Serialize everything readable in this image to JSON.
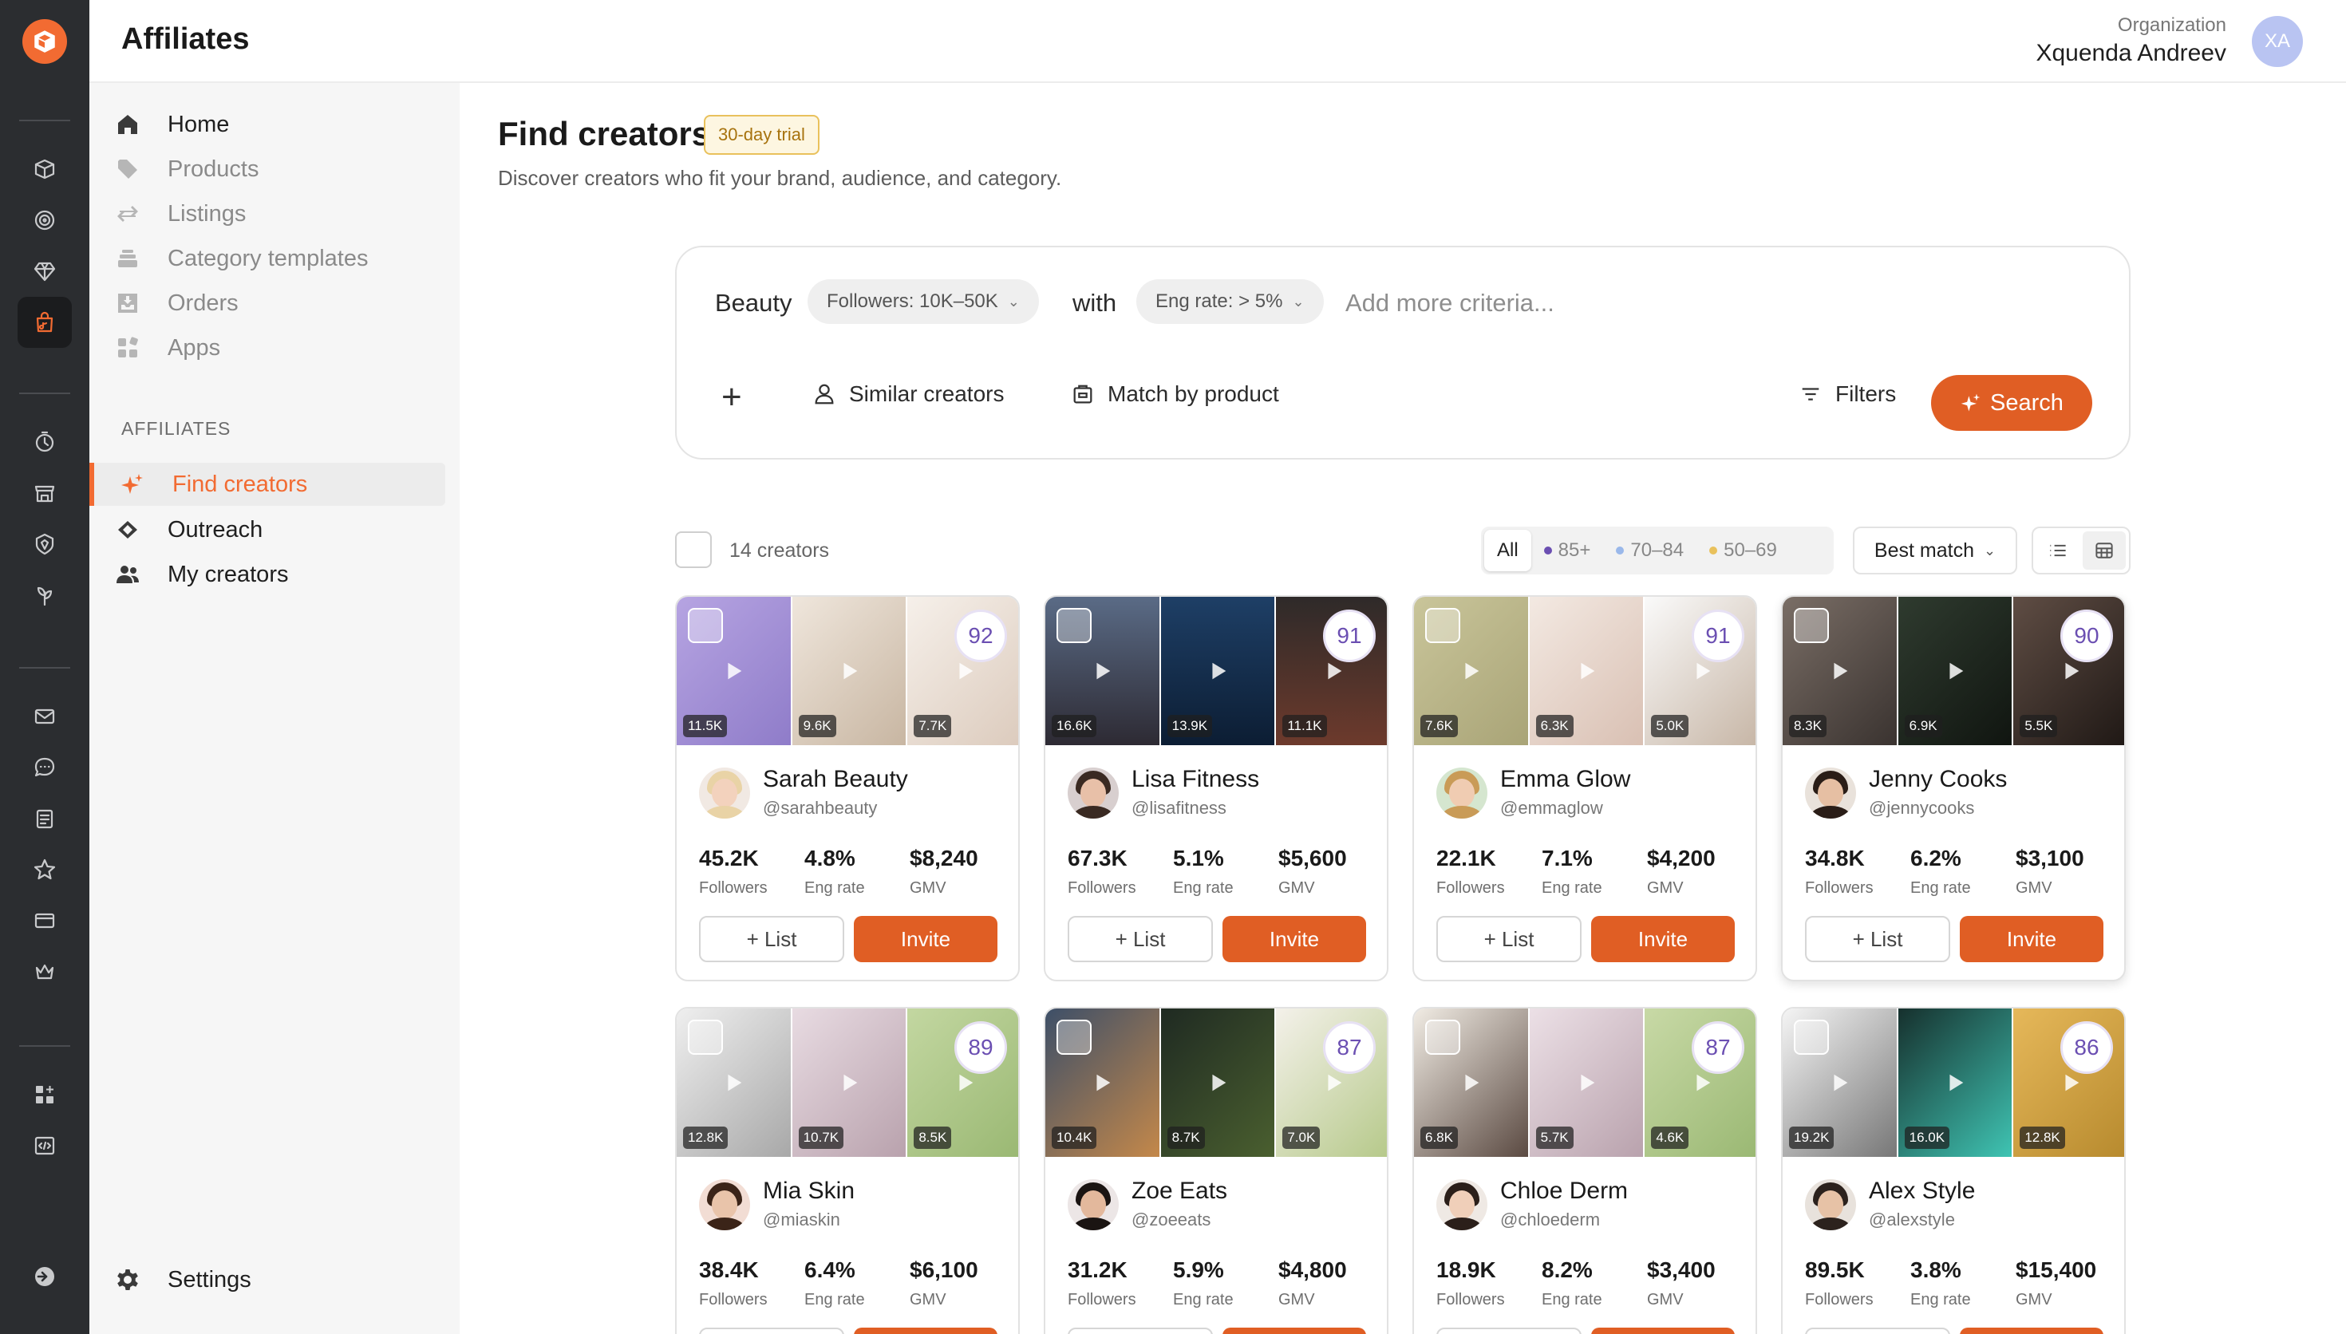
{
  "app": {
    "title": "Affiliates"
  },
  "org": {
    "label": "Organization",
    "name": "Xquenda Andreev",
    "initials": "XA"
  },
  "sidebar": {
    "items": [
      {
        "label": "Home",
        "icon": "home-icon"
      },
      {
        "label": "Products",
        "icon": "tag-icon"
      },
      {
        "label": "Listings",
        "icon": "sync-icon"
      },
      {
        "label": "Category templates",
        "icon": "stack-icon"
      },
      {
        "label": "Orders",
        "icon": "download-tray-icon"
      },
      {
        "label": "Apps",
        "icon": "apps-icon"
      }
    ],
    "section": "AFFILIATES",
    "affiliates": [
      {
        "label": "Find creators",
        "icon": "sparkle-icon"
      },
      {
        "label": "Outreach",
        "icon": "handshake-icon"
      },
      {
        "label": "My creators",
        "icon": "people-icon"
      }
    ],
    "settings": "Settings"
  },
  "page": {
    "title": "Find creators",
    "badge": "30-day trial",
    "subtitle": "Discover creators who fit your brand, audience, and category."
  },
  "search": {
    "keyword": "Beauty",
    "followers_chip": "Followers: 10K–50K",
    "with_label": "with",
    "eng_chip": "Eng rate: > 5%",
    "placeholder": "Add more criteria...",
    "add": "+",
    "similar": "Similar creators",
    "match": "Match by product",
    "filters": "Filters",
    "search_btn": "Search"
  },
  "results": {
    "count": "14 creators",
    "segments": [
      {
        "label": "All",
        "dot": ""
      },
      {
        "label": "85+",
        "dot": "#6b4fb2"
      },
      {
        "label": "70–84",
        "dot": "#9ab8ea"
      },
      {
        "label": "50–69",
        "dot": "#e9c15c"
      }
    ],
    "sort": "Best match"
  },
  "labels": {
    "followers": "Followers",
    "eng": "Eng rate",
    "gmv": "GMV",
    "list_btn": "+ List",
    "invite_btn": "Invite"
  },
  "creators": [
    {
      "name": "Sarah Beauty",
      "handle": "@sarahbeauty",
      "score": "92",
      "followers": "45.2K",
      "eng": "4.8%",
      "gmv": "$8,240",
      "views": [
        "11.5K",
        "9.6K",
        "7.7K"
      ]
    },
    {
      "name": "Lisa Fitness",
      "handle": "@lisafitness",
      "score": "91",
      "followers": "67.3K",
      "eng": "5.1%",
      "gmv": "$5,600",
      "views": [
        "16.6K",
        "13.9K",
        "11.1K"
      ]
    },
    {
      "name": "Emma Glow",
      "handle": "@emmaglow",
      "score": "91",
      "followers": "22.1K",
      "eng": "7.1%",
      "gmv": "$4,200",
      "views": [
        "7.6K",
        "6.3K",
        "5.0K"
      ]
    },
    {
      "name": "Jenny Cooks",
      "handle": "@jennycooks",
      "score": "90",
      "followers": "34.8K",
      "eng": "6.2%",
      "gmv": "$3,100",
      "views": [
        "8.3K",
        "6.9K",
        "5.5K"
      ]
    },
    {
      "name": "Mia Skin",
      "handle": "@miaskin",
      "score": "89",
      "followers": "38.4K",
      "eng": "6.4%",
      "gmv": "$6,100",
      "views": [
        "12.8K",
        "10.7K",
        "8.5K"
      ]
    },
    {
      "name": "Zoe Eats",
      "handle": "@zoeeats",
      "score": "87",
      "followers": "31.2K",
      "eng": "5.9%",
      "gmv": "$4,800",
      "views": [
        "10.4K",
        "8.7K",
        "7.0K"
      ]
    },
    {
      "name": "Chloe Derm",
      "handle": "@chloederm",
      "score": "87",
      "followers": "18.9K",
      "eng": "8.2%",
      "gmv": "$3,400",
      "views": [
        "6.8K",
        "5.7K",
        "4.6K"
      ]
    },
    {
      "name": "Alex Style",
      "handle": "@alexstyle",
      "score": "86",
      "followers": "89.5K",
      "eng": "3.8%",
      "gmv": "$15,400",
      "views": [
        "19.2K",
        "16.0K",
        "12.8K"
      ]
    }
  ],
  "colors": {
    "accent": "#e05e24",
    "brand": "#f26b32",
    "score": "#6b4fb2"
  }
}
